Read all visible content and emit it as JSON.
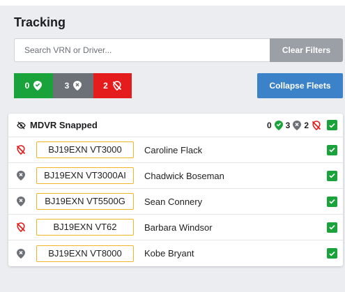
{
  "title": "Tracking",
  "search": {
    "placeholder": "Search VRN or Driver...",
    "clear_label": "Clear Filters"
  },
  "status_filters": [
    {
      "count": "0",
      "kind": "online",
      "color": "#1aa33a"
    },
    {
      "count": "3",
      "kind": "offline",
      "color": "#6c7177"
    },
    {
      "count": "2",
      "kind": "no-signal",
      "color": "#e41c1c"
    }
  ],
  "collapse_label": "Collapse Fleets",
  "fleet": {
    "name": "MDVR Snapped",
    "online": "0",
    "offline": "3",
    "no_signal": "2",
    "checked": true
  },
  "vehicles": [
    {
      "status": "no-signal",
      "vrn": "BJ19EXN VT3000",
      "driver": "Caroline Flack",
      "checked": true
    },
    {
      "status": "offline",
      "vrn": "BJ19EXN VT3000AI",
      "driver": "Chadwick Boseman",
      "checked": true
    },
    {
      "status": "offline",
      "vrn": "BJ19EXN VT5500G",
      "driver": "Sean Connery",
      "checked": true
    },
    {
      "status": "no-signal",
      "vrn": "BJ19EXN VT62",
      "driver": "Barbara Windsor",
      "checked": true
    },
    {
      "status": "offline",
      "vrn": "BJ19EXN VT8000",
      "driver": "Kobe Bryant",
      "checked": true
    }
  ],
  "colors": {
    "green": "#1aa33a",
    "grey": "#6c7177",
    "red": "#e41c1c",
    "accent": "#3b82c9",
    "plate_border": "#f0b429"
  }
}
